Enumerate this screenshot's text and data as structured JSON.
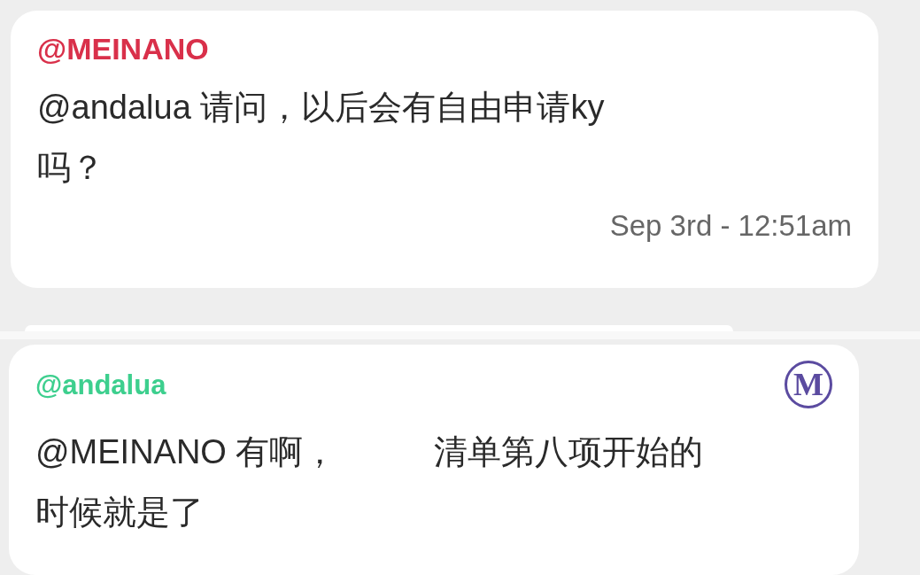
{
  "messages": [
    {
      "author": "@MEINANO",
      "kind": "member",
      "lines": [
        [
          "@andalua 请问，以后会有自由申请ky"
        ],
        [
          "吗？"
        ]
      ],
      "time": "Sep 3rd - 12:51am"
    },
    {
      "author": "@andalua",
      "kind": "moderator",
      "badge_letter": "M",
      "lines": [
        [
          "@MEINANO 有啊，",
          "清单第八项开始的"
        ],
        [
          "时候就是了"
        ]
      ]
    }
  ]
}
